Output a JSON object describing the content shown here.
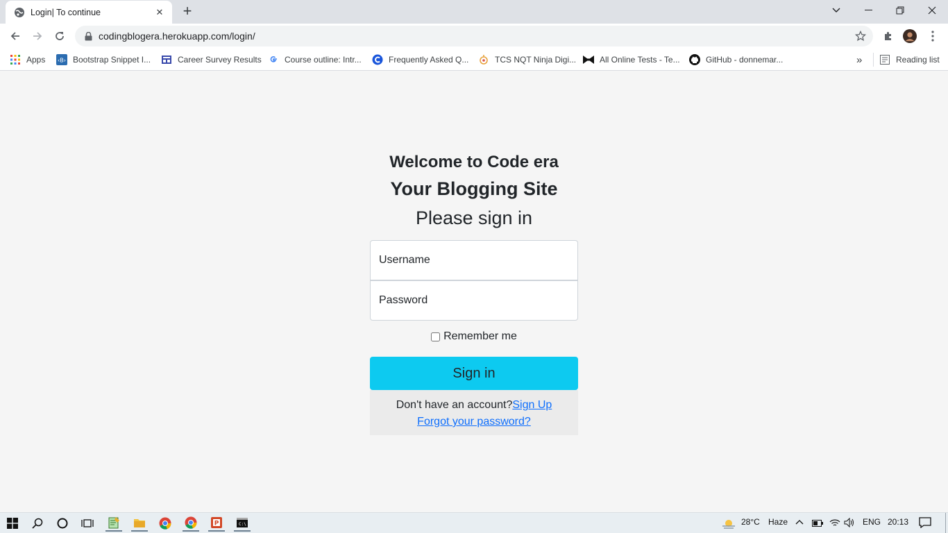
{
  "browser": {
    "tab_title": "Login| To continue",
    "url": "codingblogera.herokuapp.com/login/",
    "bookmarks": [
      {
        "label": "Apps",
        "icon": "apps-grid-icon"
      },
      {
        "label": "Bootstrap Snippet I...",
        "icon": "bootstrap-icon"
      },
      {
        "label": "Career Survey Results",
        "icon": "form-icon"
      },
      {
        "label": "Course outline: Intr...",
        "icon": "google-icon"
      },
      {
        "label": "Frequently Asked Q...",
        "icon": "c-logo-icon"
      },
      {
        "label": "TCS NQT Ninja Digi...",
        "icon": "tcs-icon"
      },
      {
        "label": "All Online Tests - Te...",
        "icon": "bowtie-icon"
      },
      {
        "label": "GitHub - donnemar...",
        "icon": "github-icon"
      }
    ],
    "more_bookmarks": "»",
    "reading_list": "Reading list"
  },
  "page": {
    "welcome": "Welcome to Code era",
    "site_title": "Your Blogging Site",
    "signin_heading": "Please sign in",
    "username_placeholder": "Username",
    "password_placeholder": "Password",
    "remember_label": "Remember me",
    "signin_button": "Sign in",
    "no_account_text": "Don't have an account?",
    "signup_link": "Sign Up",
    "forgot_link": "Forgot your password?"
  },
  "taskbar": {
    "temperature": "28°C",
    "weather": "Haze",
    "language": "ENG",
    "time": "20:13"
  },
  "colors": {
    "accent": "#0dcaf0",
    "link": "#0d6efd",
    "page_bg": "#f5f5f5"
  }
}
